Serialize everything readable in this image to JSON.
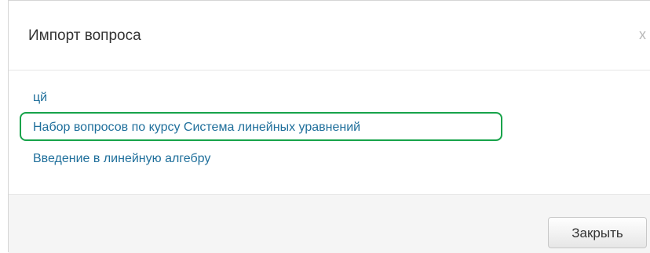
{
  "dialog": {
    "title": "Импорт вопроса",
    "close_icon_glyph": "x"
  },
  "courses": [
    {
      "label": "цй"
    },
    {
      "label": "Набор вопросов по курсу Система линейных уравнений",
      "highlighted": true
    },
    {
      "label": "Введение в линейную алгебру"
    }
  ],
  "footer": {
    "close_button_label": "Закрыть"
  },
  "colors": {
    "link": "#1f6f9b",
    "highlight": "#17a34a",
    "footer_bg": "#f5f5f5"
  }
}
